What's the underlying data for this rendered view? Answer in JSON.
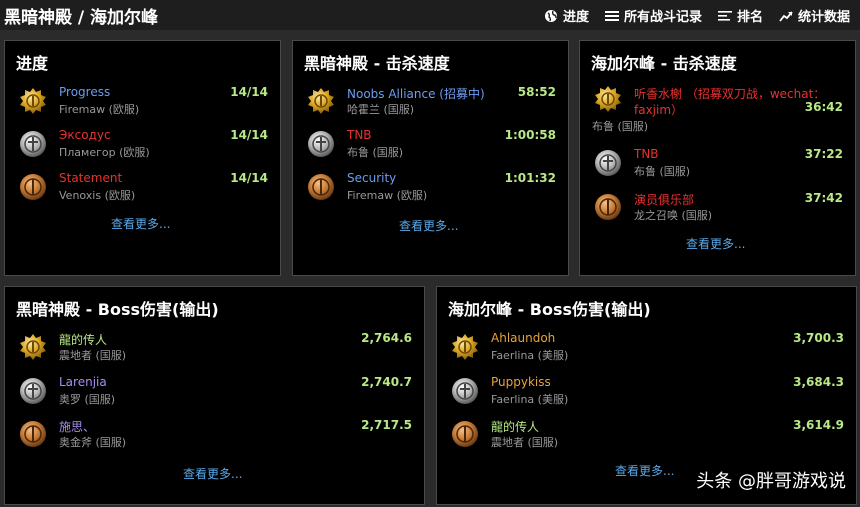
{
  "header": {
    "title": "黑暗神殿 / 海加尔峰",
    "nav": [
      {
        "label": "进度",
        "icon": "globe-icon"
      },
      {
        "label": "所有战斗记录",
        "icon": "list-icon"
      },
      {
        "label": "排名",
        "icon": "ranking-icon"
      },
      {
        "label": "统计数据",
        "icon": "trend-icon"
      }
    ]
  },
  "progress": {
    "title": "进度",
    "more": "查看更多...",
    "entries": [
      {
        "name": "Progress",
        "realm": "Firemaw (欧服)",
        "value": "14/14",
        "medal": "gold"
      },
      {
        "name": "Эксодус",
        "realm": "Пламегор (欧服)",
        "value": "14/14",
        "medal": "silver"
      },
      {
        "name": "Statement",
        "realm": "Venoxis (欧服)",
        "value": "14/14",
        "medal": "bronze"
      }
    ]
  },
  "bt_speed": {
    "title": "黑暗神殿 - 击杀速度",
    "more": "查看更多...",
    "entries": [
      {
        "name": "Noobs Alliance (招募中)",
        "realm": "哈霍兰 (国服)",
        "value": "58:52",
        "medal": "gold"
      },
      {
        "name": "TNB",
        "realm": "布鲁 (国服)",
        "value": "1:00:58",
        "medal": "silver"
      },
      {
        "name": "Security",
        "realm": "Firemaw (欧服)",
        "value": "1:01:32",
        "medal": "bronze"
      }
    ]
  },
  "hyjal_speed": {
    "title": "海加尔峰 - 击杀速度",
    "more": "查看更多...",
    "entries": [
      {
        "name_line1": "听香水榭 （招募双刀战，wechat：",
        "name_line2": "faxjim）",
        "realm": "布鲁 (国服)",
        "value": "36:42",
        "medal": "gold"
      },
      {
        "name": "TNB",
        "realm": "布鲁 (国服)",
        "value": "37:22",
        "medal": "silver"
      },
      {
        "name": "演员俱乐部",
        "realm": "龙之召唤 (国服)",
        "value": "37:42",
        "medal": "bronze"
      }
    ]
  },
  "bt_damage": {
    "title": "黑暗神殿 - Boss伤害(输出)",
    "more": "查看更多...",
    "entries": [
      {
        "name": "龍的传人",
        "realm": "震地者 (国服)",
        "value": "2,764.6",
        "medal": "gold"
      },
      {
        "name": "Larenjia",
        "realm": "奥罗 (国服)",
        "value": "2,740.7",
        "medal": "silver"
      },
      {
        "name": "施思、",
        "realm": "奥金斧 (国服)",
        "value": "2,717.5",
        "medal": "bronze"
      }
    ]
  },
  "hyjal_damage": {
    "title": "海加尔峰 - Boss伤害(输出)",
    "more": "查看更多...",
    "entries": [
      {
        "name": "Ahlaundoh",
        "realm": "Faerlina (美服)",
        "value": "3,700.3",
        "medal": "gold"
      },
      {
        "name": "Puppykiss",
        "realm": "Faerlina (美服)",
        "value": "3,684.3",
        "medal": "silver"
      },
      {
        "name": "龍的传人",
        "realm": "震地者 (国服)",
        "value": "3,614.9",
        "medal": "bronze"
      }
    ]
  },
  "watermark": "头条 @胖哥游戏说",
  "colors": {
    "gold": "#d9a520",
    "silver": "#b5b5b5",
    "bronze": "#c77b35",
    "link": "#5aa8e8",
    "value": "#b8e986"
  }
}
